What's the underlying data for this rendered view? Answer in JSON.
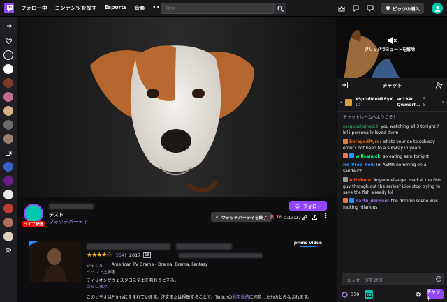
{
  "topbar": {
    "nav": [
      "フォロー中",
      "コンテンツを探す",
      "Esports",
      "音楽"
    ],
    "more": "•••",
    "search_placeholder": "検索",
    "bits_label": "ビッツの購入"
  },
  "sidebar": {
    "icons": [
      "collapse-icon",
      "heart-icon",
      "channel-avatar",
      "channel-avatar",
      "channel-avatar",
      "channel-avatar",
      "channel-avatar",
      "channel-avatar",
      "camera-icon",
      "channel-avatar",
      "channel-avatar",
      "channel-avatar",
      "channel-avatar",
      "channel-avatar",
      "channel-avatar",
      "add-friend-icon"
    ],
    "avatar_colors": [
      "#2b2b2b",
      "#ffffff",
      "#7a3a2a",
      "#c46a8a",
      "#d7b08a",
      "#6a6a6a",
      "#9a8070",
      "#3c5fd0",
      "#6a1e8a",
      "#e8e8e8",
      "#c03a3a",
      "#b07060",
      "#e0d0c0"
    ]
  },
  "mini_player": {
    "unmute_label": "クリックでミュートを解除"
  },
  "chat": {
    "title": "チャット",
    "gifts": [
      {
        "name": "XSpUdMoNkEyX",
        "count": "10"
      },
      {
        "name": "ac194c",
        "count": "5"
      },
      {
        "name": "Qwmorf...",
        "count": "5"
      }
    ],
    "welcome": "チャットルームへようこそ！",
    "messages": [
      {
        "user": "mrgoodwine23",
        "color": "#2e8b57",
        "text": ": you watching all 3 tonight ? lol i personally loved them"
      },
      {
        "user": "EnragedPyro",
        "color": "#d2691e",
        "text": ": whats your go to subway order? not been to a subway in years"
      },
      {
        "user": "willcanuck",
        "color": "#00ff7f",
        "text": ": so eating asm tonight"
      },
      {
        "user": "No_Prob_Rob",
        "color": "#1e90ff",
        "text": ": lol ASMR nomming on a sandwich"
      },
      {
        "user": "Adridenn",
        "color": "#ff4500",
        "text": ": Anyone else get mad at the fish guy through out the series? Like stop trying to save the fish already lol"
      },
      {
        "user": "darth_derpius",
        "color": "#9370db",
        "text": ": the dolphin scene was fucking hilarious"
      }
    ],
    "input_placeholder": "メッセージを送信",
    "points": "370",
    "send_label": "チャット"
  },
  "channel": {
    "live_label": "ライブ配信",
    "title": "テスト",
    "category": "ウォッチパーティ",
    "follow_label": "フォロー",
    "end_party_label": "ウォッチパーティを終了",
    "viewers": "78",
    "uptime": "0:13:27"
  },
  "show": {
    "rating_count": "(554)",
    "year": "2017",
    "content_rating": "18",
    "genre_label": "ジャンル",
    "genre_value": "American TV Drama - Drama, Drama, Fantasy",
    "event_label": "イベント主催者",
    "description": "ティリオンがウェスタロス全土を救おうとする。",
    "more_label": "さらに表示",
    "notice_prefix": "このビデオはPrimeに含まれています。注文または視聴することで、Twitchの",
    "notice_link": "利用規約",
    "notice_suffix": "に同意したものとみなされます。",
    "brand": "prime video"
  }
}
